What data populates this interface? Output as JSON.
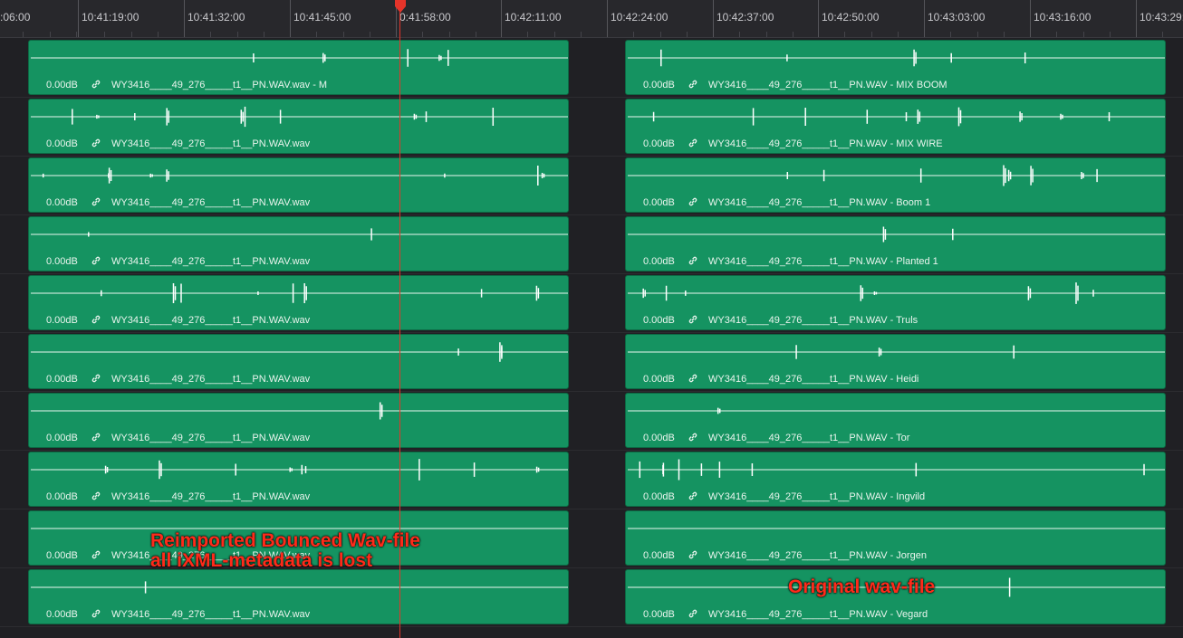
{
  "ruler": {
    "ticks": [
      ":06:00",
      "10:41:19:00",
      "10:41:32:00",
      "10:41:45:00",
      "0:41:58:00",
      "10:42:11:00",
      "10:42:24:00",
      "10:42:37:00",
      "10:42:50:00",
      "10:43:03:00",
      "10:43:16:00",
      "10:43:29:"
    ]
  },
  "icons": {
    "link": "link-icon",
    "playhead": "playhead-marker-icon"
  },
  "colors": {
    "clip": "#159361",
    "playhead": "#e5342a",
    "annotation": "#ff2a1a"
  },
  "left_clips": [
    {
      "volume": "0.00dB",
      "name": "WY3416____49_276_____t1__PN.WAV.wav - M"
    },
    {
      "volume": "0.00dB",
      "name": "WY3416____49_276_____t1__PN.WAV.wav"
    },
    {
      "volume": "0.00dB",
      "name": "WY3416____49_276_____t1__PN.WAV.wav"
    },
    {
      "volume": "0.00dB",
      "name": "WY3416____49_276_____t1__PN.WAV.wav"
    },
    {
      "volume": "0.00dB",
      "name": "WY3416____49_276_____t1__PN.WAV.wav"
    },
    {
      "volume": "0.00dB",
      "name": "WY3416____49_276_____t1__PN.WAV.wav"
    },
    {
      "volume": "0.00dB",
      "name": "WY3416____49_276_____t1__PN.WAV.wav"
    },
    {
      "volume": "0.00dB",
      "name": "WY3416____49_276_____t1__PN.WAV.wav"
    },
    {
      "volume": "0.00dB",
      "name": "WY3416____49_276_____t1__PN.WAV.wav"
    },
    {
      "volume": "0.00dB",
      "name": "WY3416____49_276_____t1__PN.WAV.wav"
    }
  ],
  "right_clips": [
    {
      "volume": "0.00dB",
      "name": "WY3416____49_276_____t1__PN.WAV - MIX BOOM"
    },
    {
      "volume": "0.00dB",
      "name": "WY3416____49_276_____t1__PN.WAV - MIX WIRE"
    },
    {
      "volume": "0.00dB",
      "name": "WY3416____49_276_____t1__PN.WAV - Boom 1"
    },
    {
      "volume": "0.00dB",
      "name": "WY3416____49_276_____t1__PN.WAV - Planted 1"
    },
    {
      "volume": "0.00dB",
      "name": "WY3416____49_276_____t1__PN.WAV - Truls"
    },
    {
      "volume": "0.00dB",
      "name": "WY3416____49_276_____t1__PN.WAV - Heidi"
    },
    {
      "volume": "0.00dB",
      "name": "WY3416____49_276_____t1__PN.WAV - Tor"
    },
    {
      "volume": "0.00dB",
      "name": "WY3416____49_276_____t1__PN.WAV - Ingvild"
    },
    {
      "volume": "0.00dB",
      "name": "WY3416____49_276_____t1__PN.WAV - Jorgen"
    },
    {
      "volume": "0.00dB",
      "name": "WY3416____49_276_____t1__PN.WAV - Vegard"
    }
  ],
  "annotations": {
    "left_line1": "Reimported Bounced Wav-file",
    "left_line2": "all iXML-metadata is lost",
    "right": "Original wav-file"
  }
}
